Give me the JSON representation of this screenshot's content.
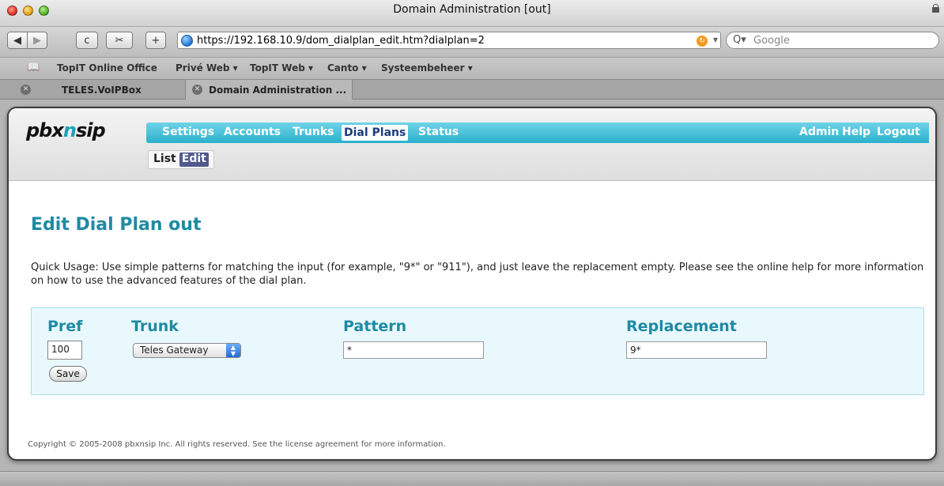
{
  "window": {
    "title": "Domain Administration [out]"
  },
  "toolbar": {
    "back": "◀",
    "forward": "▶",
    "reload": "c",
    "snip": "✂",
    "add": "+",
    "url": "https://192.168.10.9/dom_dialplan_edit.htm?dialplan=2",
    "search_placeholder": "Google"
  },
  "bookmarks": [
    "TopIT Online Office",
    "Privé Web ▾",
    "TopIT Web ▾",
    "Canto ▾",
    "Systeembeheer ▾"
  ],
  "tabs": [
    {
      "label": "TELES.VoIPBox"
    },
    {
      "label": "Domain Administration ..."
    }
  ],
  "app": {
    "logo_prefix": "pbx",
    "logo_n": "n",
    "logo_suffix": "sip",
    "nav": [
      "Settings",
      "Accounts",
      "Trunks",
      "Dial Plans",
      "Status"
    ],
    "nav_active": "Dial Plans",
    "nav_right": [
      "Admin",
      "Help",
      "Logout"
    ],
    "subnav": {
      "list": "List",
      "edit": "Edit"
    }
  },
  "page": {
    "title": "Edit Dial Plan out",
    "usage": "Quick Usage: Use simple patterns for matching the input (for example, \"9*\" or \"911\"), and just leave the replacement empty. Please see the online help for more information on how to use the advanced features of the dial plan.",
    "columns": {
      "pref": "Pref",
      "trunk": "Trunk",
      "pattern": "Pattern",
      "replacement": "Replacement"
    },
    "values": {
      "pref": "100",
      "trunk": "Teles Gateway",
      "pattern": "*",
      "replacement": "9*"
    },
    "save_label": "Save",
    "copyright": "Copyright © 2005-2008 pbxnsip Inc. All rights reserved. See the license agreement for more information."
  }
}
